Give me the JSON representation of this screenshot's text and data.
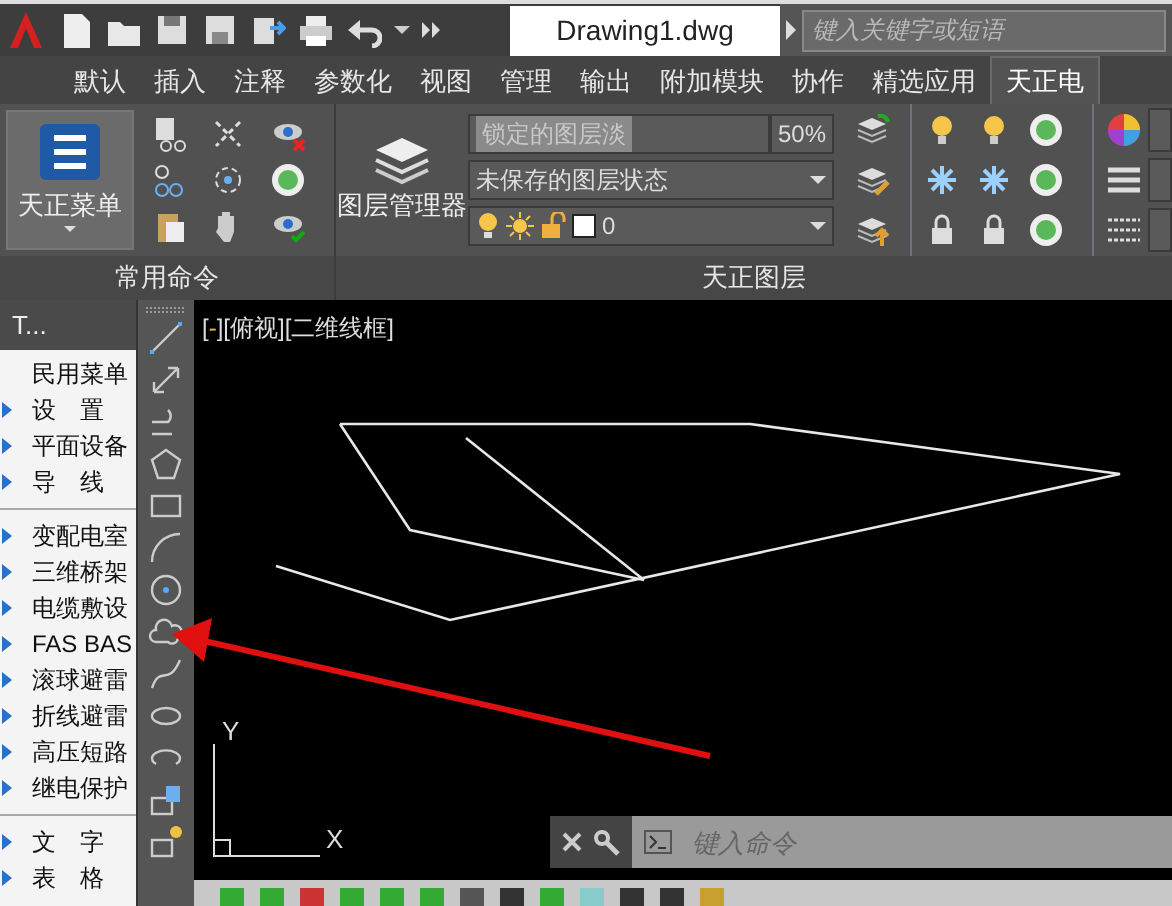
{
  "title_bar": {
    "document_tab": "Drawing1.dwg",
    "search": {
      "placeholder": "键入关键字或短语"
    }
  },
  "ribbon_tabs": [
    {
      "label": "默认",
      "selected": false
    },
    {
      "label": "插入",
      "selected": false
    },
    {
      "label": "注释",
      "selected": false
    },
    {
      "label": "参数化",
      "selected": false
    },
    {
      "label": "视图",
      "selected": false
    },
    {
      "label": "管理",
      "selected": false
    },
    {
      "label": "输出",
      "selected": false
    },
    {
      "label": "附加模块",
      "selected": false
    },
    {
      "label": "协作",
      "selected": false
    },
    {
      "label": "精选应用",
      "selected": false
    },
    {
      "label": "天正电",
      "selected": true
    }
  ],
  "ribbon": {
    "menu_button": "天正菜单",
    "common_panel_title": "常用命令",
    "layer_manager": "图层管理器",
    "layer_fade": {
      "value": "锁定的图层淡",
      "percent": "50%"
    },
    "layer_state": "未保存的图层状态",
    "current_layer": "0",
    "layer_panel_title": "天正图层"
  },
  "palette": {
    "title": "T...",
    "groups": [
      {
        "items": [
          {
            "label": "民用菜单",
            "has_submenu": false
          },
          {
            "label": "设　置",
            "has_submenu": true
          },
          {
            "label": "平面设备",
            "has_submenu": true
          },
          {
            "label": "导　线",
            "has_submenu": true
          }
        ]
      },
      {
        "items": [
          {
            "label": "变配电室",
            "has_submenu": true
          },
          {
            "label": "三维桥架",
            "has_submenu": true
          },
          {
            "label": "电缆敷设",
            "has_submenu": true
          },
          {
            "label": "FAS BAS",
            "has_submenu": true
          },
          {
            "label": "滚球避雷",
            "has_submenu": true
          },
          {
            "label": "折线避雷",
            "has_submenu": true
          },
          {
            "label": "高压短路",
            "has_submenu": true
          },
          {
            "label": "继电保护",
            "has_submenu": true
          }
        ]
      },
      {
        "items": [
          {
            "label": "文　字",
            "has_submenu": true
          },
          {
            "label": "表　格",
            "has_submenu": true
          }
        ]
      }
    ]
  },
  "viewport": {
    "label_open": "[",
    "label_minus": "-",
    "label_rest": "][俯视][二维线框]",
    "ucs_y": "Y",
    "ucs_x": "X"
  },
  "command_line": {
    "placeholder": "键入命令"
  }
}
